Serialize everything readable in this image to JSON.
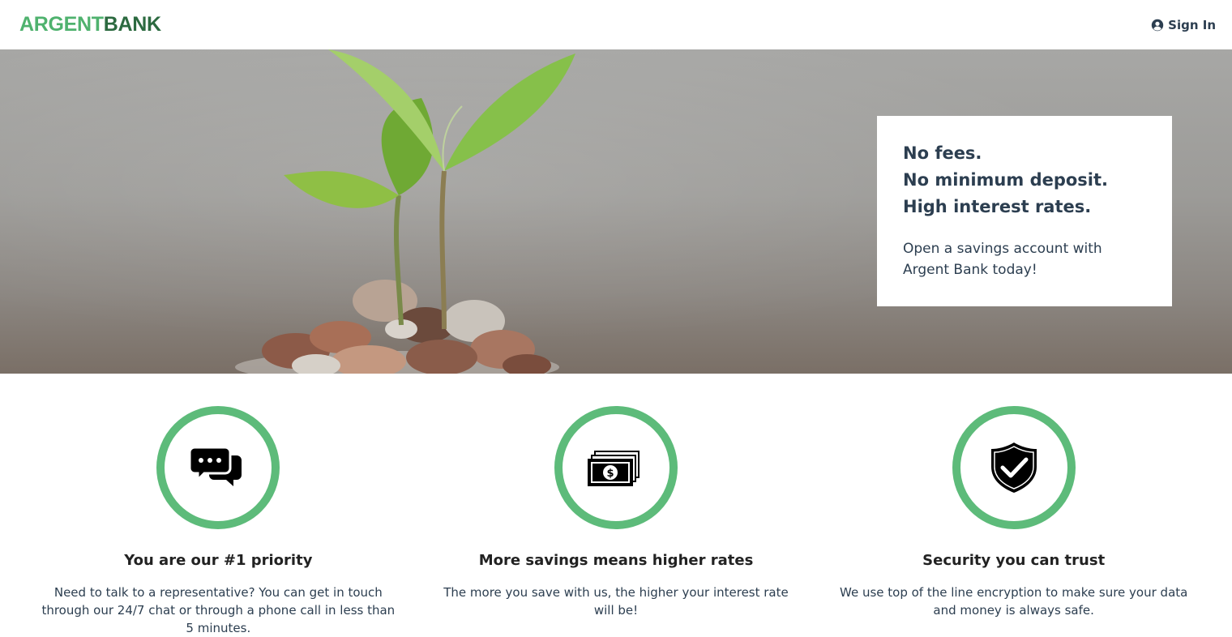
{
  "nav": {
    "logo_part1": "ARGENT",
    "logo_part2": "BANK",
    "signin_label": "Sign In",
    "signin_icon": "user-circle-icon"
  },
  "hero": {
    "promo_lines": [
      "No fees.",
      "No minimum deposit.",
      "High interest rates."
    ],
    "promo_text": "Open a savings account with Argent Bank today!"
  },
  "features": [
    {
      "icon": "chat-icon",
      "title": "You are our #1 priority",
      "description": "Need to talk to a representative? You can get in touch through our 24/7 chat or through a phone call in less than 5 minutes."
    },
    {
      "icon": "money-icon",
      "title": "More savings means higher rates",
      "description": "The more you save with us, the higher your interest rate will be!"
    },
    {
      "icon": "security-shield-icon",
      "title": "Security you can trust",
      "description": "We use top of the line encryption to make sure your data and money is always safe."
    }
  ],
  "colors": {
    "brand_light": "#4fb26e",
    "brand_dark": "#2c6a40",
    "ring": "#5dbb7a",
    "text": "#2c3e50"
  }
}
